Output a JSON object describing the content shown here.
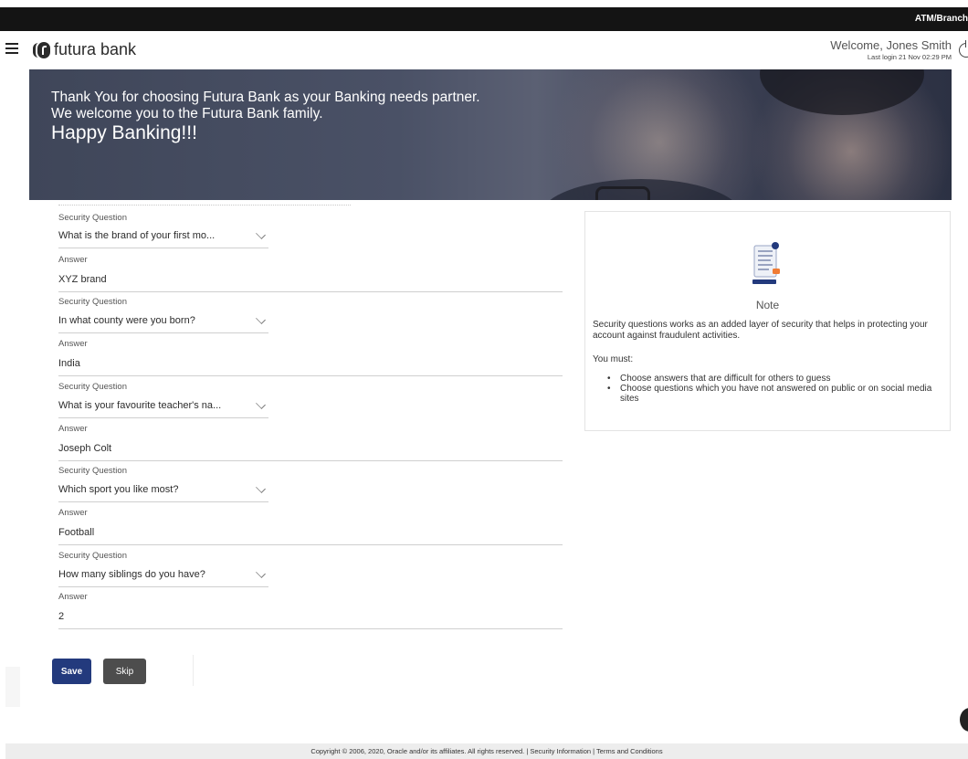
{
  "topbar": {
    "label": "ATM/Branch"
  },
  "header": {
    "brand": "futura bank",
    "welcome": "Welcome, Jones Smith",
    "last_login": "Last login 21 Nov 02:29 PM"
  },
  "banner": {
    "line1": "Thank You for choosing Futura Bank as your Banking needs partner.",
    "line2": "We welcome you to the Futura Bank family.",
    "line3": "Happy Banking!!!"
  },
  "form": {
    "question_label": "Security Question",
    "answer_label": "Answer",
    "items": [
      {
        "question": "What is the brand of your first mo...",
        "answer": "XYZ brand"
      },
      {
        "question": "In what county were you born?",
        "answer": "India"
      },
      {
        "question": "What is your favourite teacher's na...",
        "answer": "Joseph Colt"
      },
      {
        "question": "Which sport you like most?",
        "answer": "Football"
      },
      {
        "question": "How many siblings do you have?",
        "answer": "2"
      }
    ]
  },
  "buttons": {
    "save": "Save",
    "skip": "Skip"
  },
  "note": {
    "title": "Note",
    "body": "Security questions works as an added layer of security that helps in protecting your account against fraudulent activities.",
    "must": "You must:",
    "points": [
      "Choose answers that are difficult for others to guess",
      "Choose questions which you have not answered on public or on social media sites"
    ]
  },
  "footer": {
    "copyright": "Copyright © 2006, 2020, Oracle and/or its affiliates. All rights reserved. | Security Information | Terms and Conditions"
  },
  "colors": {
    "primary": "#233a7d",
    "secondary": "#4d4d4d",
    "topbar": "#141414"
  },
  "icons": [
    "menu-icon",
    "futura-logo-icon",
    "power-icon",
    "chevron-down-icon",
    "note-document-icon",
    "chat-fab-icon"
  ]
}
